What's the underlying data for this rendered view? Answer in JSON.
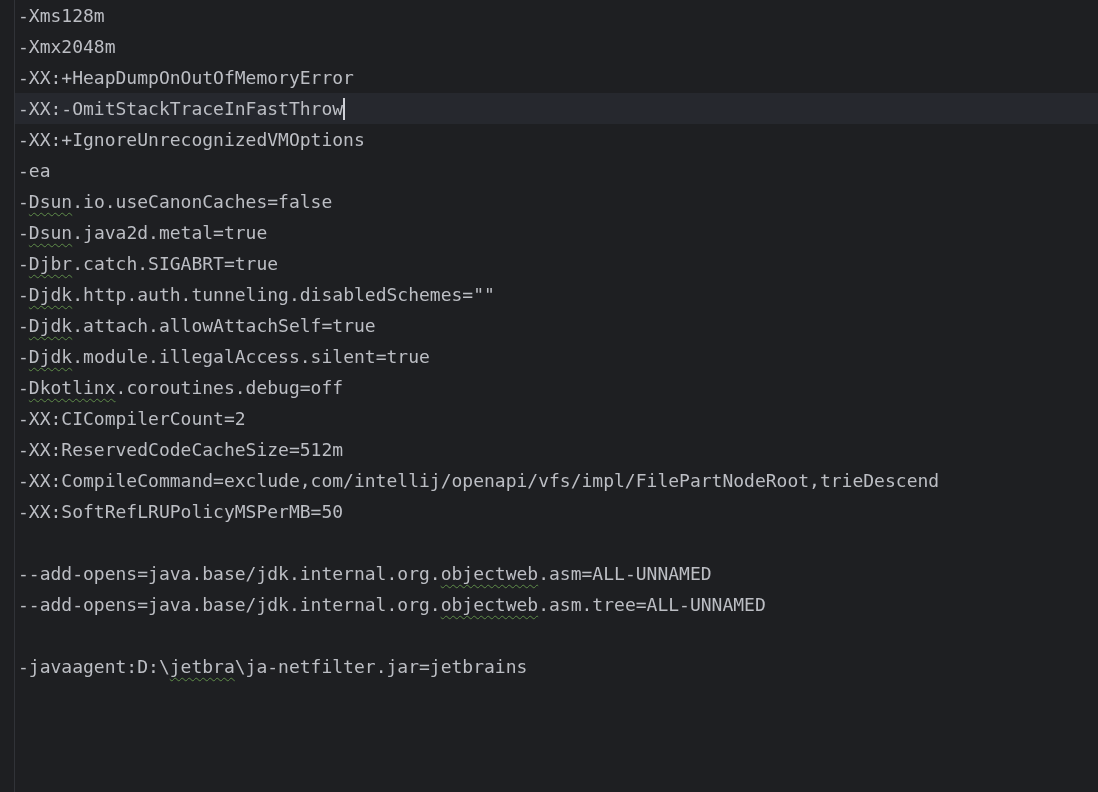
{
  "editor": {
    "lines": [
      {
        "kind": "code",
        "current": false,
        "parts": [
          {
            "text": "-Xms128m"
          }
        ]
      },
      {
        "kind": "code",
        "current": false,
        "parts": [
          {
            "text": "-Xmx2048m"
          }
        ]
      },
      {
        "kind": "code",
        "current": false,
        "parts": [
          {
            "text": "-XX:+HeapDumpOnOutOfMemoryError"
          }
        ]
      },
      {
        "kind": "code",
        "current": true,
        "parts": [
          {
            "text": "-XX:-OmitStackTraceInFastThrow"
          }
        ]
      },
      {
        "kind": "code",
        "current": false,
        "parts": [
          {
            "text": "-XX:+IgnoreUnrecognizedVMOptions"
          }
        ]
      },
      {
        "kind": "code",
        "current": false,
        "parts": [
          {
            "text": "-ea"
          }
        ]
      },
      {
        "kind": "code",
        "current": false,
        "parts": [
          {
            "text": "-"
          },
          {
            "text": "Dsun",
            "typo": true
          },
          {
            "text": ".io.useCanonCaches=false"
          }
        ]
      },
      {
        "kind": "code",
        "current": false,
        "parts": [
          {
            "text": "-"
          },
          {
            "text": "Dsun",
            "typo": true
          },
          {
            "text": ".java2d.metal=true"
          }
        ]
      },
      {
        "kind": "code",
        "current": false,
        "parts": [
          {
            "text": "-"
          },
          {
            "text": "Djbr",
            "typo": true
          },
          {
            "text": ".catch.SIGABRT=true"
          }
        ]
      },
      {
        "kind": "code",
        "current": false,
        "parts": [
          {
            "text": "-"
          },
          {
            "text": "Djdk",
            "typo": true
          },
          {
            "text": ".http.auth.tunneling.disabledSchemes=\"\""
          }
        ]
      },
      {
        "kind": "code",
        "current": false,
        "parts": [
          {
            "text": "-"
          },
          {
            "text": "Djdk",
            "typo": true
          },
          {
            "text": ".attach.allowAttachSelf=true"
          }
        ]
      },
      {
        "kind": "code",
        "current": false,
        "parts": [
          {
            "text": "-"
          },
          {
            "text": "Djdk",
            "typo": true
          },
          {
            "text": ".module.illegalAccess.silent=true"
          }
        ]
      },
      {
        "kind": "code",
        "current": false,
        "parts": [
          {
            "text": "-"
          },
          {
            "text": "Dkotlinx",
            "typo": true
          },
          {
            "text": ".coroutines.debug=off"
          }
        ]
      },
      {
        "kind": "code",
        "current": false,
        "parts": [
          {
            "text": "-XX:CICompilerCount=2"
          }
        ]
      },
      {
        "kind": "code",
        "current": false,
        "parts": [
          {
            "text": "-XX:ReservedCodeCacheSize=512m"
          }
        ]
      },
      {
        "kind": "code",
        "current": false,
        "parts": [
          {
            "text": "-XX:CompileCommand=exclude,com/intellij/openapi/vfs/impl/FilePartNodeRoot,trieDescend"
          }
        ]
      },
      {
        "kind": "code",
        "current": false,
        "parts": [
          {
            "text": "-XX:SoftRefLRUPolicyMSPerMB=50"
          }
        ]
      },
      {
        "kind": "blank",
        "current": false
      },
      {
        "kind": "code",
        "current": false,
        "parts": [
          {
            "text": "--add-opens=java.base/jdk.internal.org."
          },
          {
            "text": "objectweb",
            "typo": true
          },
          {
            "text": ".asm=ALL-UNNAMED"
          }
        ]
      },
      {
        "kind": "code",
        "current": false,
        "parts": [
          {
            "text": "--add-opens=java.base/jdk.internal.org."
          },
          {
            "text": "objectweb",
            "typo": true
          },
          {
            "text": ".asm.tree=ALL-UNNAMED"
          }
        ]
      },
      {
        "kind": "blank",
        "current": false
      },
      {
        "kind": "code",
        "current": false,
        "parts": [
          {
            "text": "-javaagent:D:\\"
          },
          {
            "text": "jetbra",
            "typo": true
          },
          {
            "text": "\\ja-netfilter.jar=jetbrains"
          }
        ]
      }
    ]
  }
}
